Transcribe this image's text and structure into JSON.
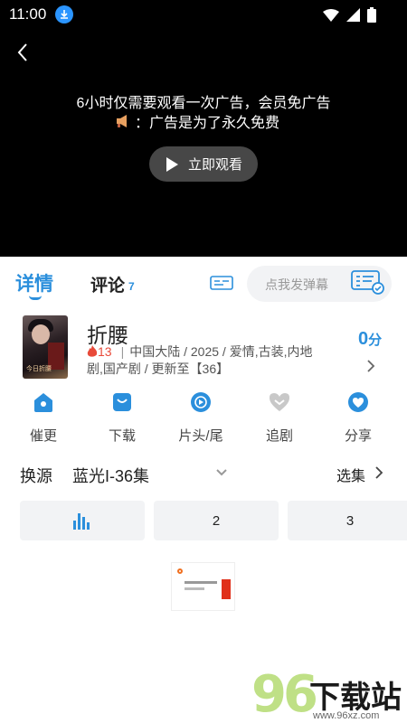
{
  "status_bar": {
    "time": "11:00"
  },
  "player": {
    "ad_line1": "6小时仅需要观看一次广告，会员免广告",
    "ad_line2": "：广告是为了永久免费",
    "watch_button": "立即观看"
  },
  "tabs": {
    "detail": "详情",
    "comment": "评论",
    "comment_count": "7",
    "danmaku_placeholder": "点我发弹幕"
  },
  "show": {
    "title": "折腰",
    "heat": "13",
    "meta_line1": "中国大陆 / 2025 / 爱情,古装,内地",
    "meta_line2": "剧,国产剧 / 更新至【36】",
    "score": "0",
    "score_unit": "分",
    "poster_caption": "今日折腰"
  },
  "actions": [
    {
      "label": "催更",
      "icon": "house-icon"
    },
    {
      "label": "下载",
      "icon": "bag-icon"
    },
    {
      "label": "片头/尾",
      "icon": "play-circle-icon"
    },
    {
      "label": "追剧",
      "icon": "heart-icon"
    },
    {
      "label": "分享",
      "icon": "share-heart-icon"
    }
  ],
  "source": {
    "label": "换源",
    "value": "蓝光I-36集",
    "episodes_link": "选集"
  },
  "episodes": [
    "",
    "2",
    "3"
  ],
  "watermark": {
    "text": "下载站",
    "url": "www.96xz.com"
  },
  "colors": {
    "accent": "#2b8fdc",
    "heat": "#e84a3a"
  }
}
